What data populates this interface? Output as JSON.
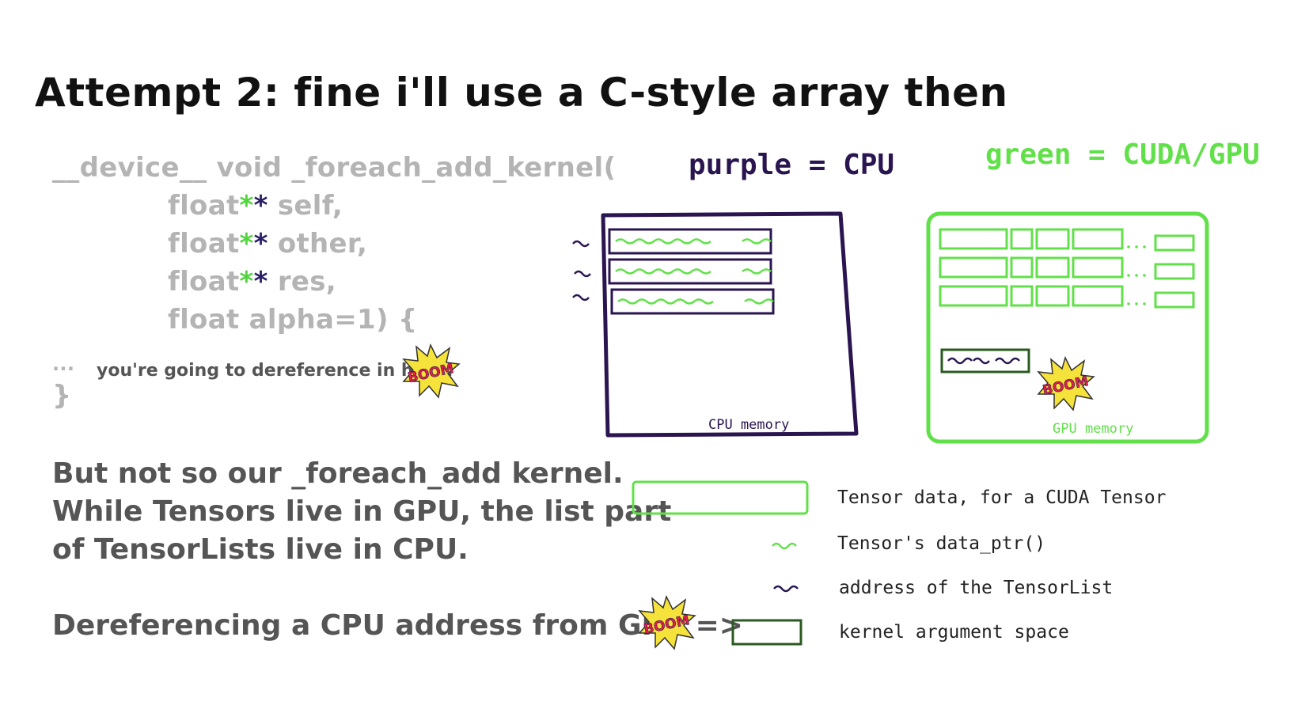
{
  "title": "Attempt 2: fine i'll use a C-style array then",
  "code": {
    "line1": "__device__ void _foreach_add_kernel(",
    "line2_pre": "float",
    "line2_post": " self,",
    "line3_pre": "float",
    "line3_post": " other,",
    "line4_pre": "float",
    "line4_post": " res,",
    "line5": "float alpha=1) {",
    "ellipsis": "...",
    "comment": "you're going to dereference in here!",
    "closing": "}",
    "star": "*"
  },
  "body": {
    "para1_line1": "But not so our _foreach_add kernel.",
    "para1_line2": "While Tensors live in GPU, the list part",
    "para1_line3": "of TensorLists live in CPU.",
    "para2": "Dereferencing a CPU address from GPU =>"
  },
  "diagram": {
    "purple_label": "purple = CPU",
    "green_label": "green = CUDA/GPU",
    "cpu_memory": "CPU memory",
    "gpu_memory": "GPU memory",
    "boom": "BOOM"
  },
  "legend": {
    "item1": "Tensor data, for a CUDA Tensor",
    "item2": "Tensor's data_ptr()",
    "item3": "address of the TensorList",
    "item4": "kernel argument space"
  },
  "colors": {
    "purple": "#2a1550",
    "green": "#62e04a",
    "gray_text": "#555555",
    "code_gray": "#b4b4b4",
    "boom_yellow": "#f5e23a",
    "boom_red": "#e0204a"
  }
}
